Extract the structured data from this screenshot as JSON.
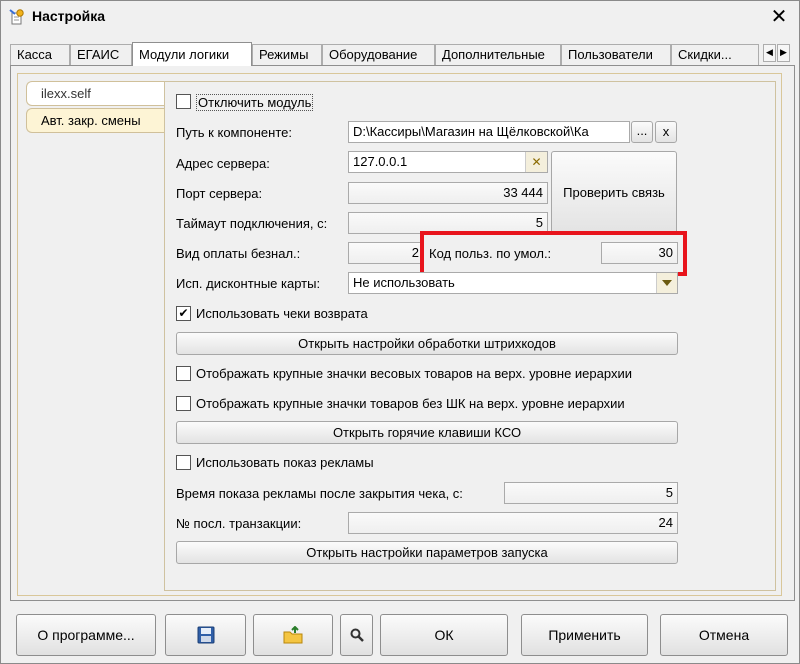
{
  "window": {
    "title": "Настройка",
    "close_glyph": "✕"
  },
  "tabs": [
    "Касса",
    "ЕГАИС",
    "Модули логики",
    "Режимы",
    "Оборудование",
    "Дополнительные",
    "Пользователи",
    "Скидки..."
  ],
  "tab_nav": {
    "left": "◀",
    "right": "▶"
  },
  "modules": [
    "ilexx.self",
    "Авт. закр. смены"
  ],
  "form": {
    "disable_module": "Отключить модуль",
    "component_path_label": "Путь к компоненте:",
    "component_path_value": "D:\\Кассиры\\Магазин на Щёлковской\\Ка",
    "browse_label": "...",
    "clear_label": "x",
    "server_address_label": "Адрес сервера:",
    "server_address_value": "127.0.0.1",
    "server_address_clear": "✕",
    "check_connection": "Проверить связь",
    "server_port_label": "Порт сервера:",
    "server_port_value": "33 444",
    "timeout_label": "Таймаут подключения, с:",
    "timeout_value": "5",
    "cashless_label": "Вид оплаты безнал.:",
    "cashless_value": "2",
    "default_user_label": "Код польз. по умол.:",
    "default_user_value": "30",
    "discount_cards_label": "Исп. дисконтные карты:",
    "discount_cards_value": "Не использовать",
    "use_return_checks": "Использовать чеки возврата",
    "open_barcode_settings": "Открыть настройки обработки штрихкодов",
    "large_icons_weight": "Отображать крупные значки весовых товаров на верх. уровне иерархии",
    "large_icons_nobarcode": "Отображать крупные значки товаров без ШК на верх. уровне иерархии",
    "open_hotkeys": "Открыть горячие клавиши КСО",
    "use_ads": "Использовать показ рекламы",
    "ad_time_label": "Время показа рекламы после закрытия чека, с:",
    "ad_time_value": "5",
    "last_transaction_label": "№ посл. транзакции:",
    "last_transaction_value": "24",
    "open_launch_params": "Открыть настройки параметров запуска"
  },
  "checks": {
    "disable_module": false,
    "use_return_checks": true,
    "large_icons_weight": false,
    "large_icons_nobarcode": false,
    "use_ads": false
  },
  "bottom": {
    "about": "О программе...",
    "save_icon": "floppy-disk-icon",
    "export_icon": "folder-export-icon",
    "search_icon": "magnifier-icon",
    "ok": "ОК",
    "apply": "Применить",
    "cancel": "Отмена"
  },
  "colors": {
    "highlight": "#e8141c",
    "tab_panel_border": "#d9c79a",
    "module_tab_bg": "#fdf4d5"
  }
}
